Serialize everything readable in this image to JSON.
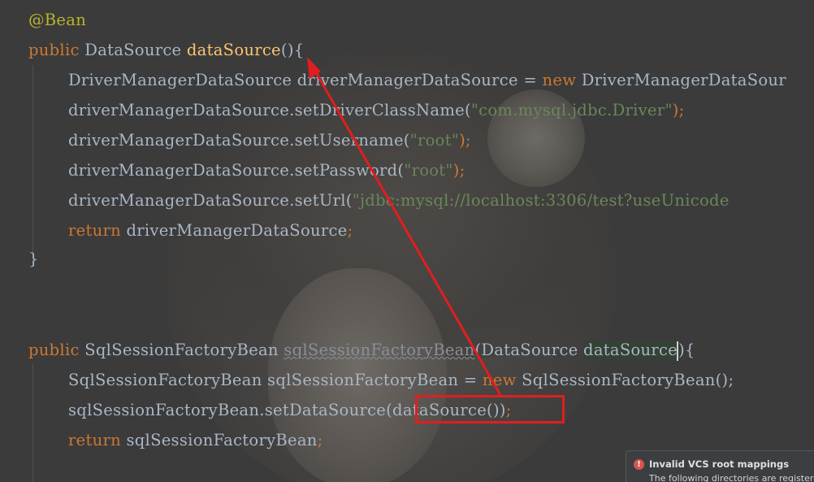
{
  "code_lines": {
    "l1": {
      "annotation": "@Bean"
    },
    "l2": {
      "kw": "public ",
      "type": "DataSource ",
      "method": "dataSource",
      "rest": "(){"
    },
    "l3": {
      "a": "DriverManagerDataSource driverManagerDataSource = ",
      "kw": "new",
      "b": " DriverManagerDataSour"
    },
    "l4": {
      "a": "driverManagerDataSource.setDriverClassName(",
      "str": "\"com.mysql.jdbc.Driver\"",
      "b": ");"
    },
    "l5": {
      "a": "driverManagerDataSource.setUsername(",
      "str": "\"root\"",
      "b": ");"
    },
    "l6": {
      "a": "driverManagerDataSource.setPassword(",
      "str": "\"root\"",
      "b": ");"
    },
    "l7": {
      "a": "driverManagerDataSource.setUrl(",
      "str": "\"jdbc:mysql://localhost:3306/test?useUnicode"
    },
    "l8": {
      "kw": "return ",
      "a": "driverManagerDataSource",
      "b": ";"
    },
    "l9": {
      "a": "}"
    },
    "l10": {
      "kw": "public ",
      "type": "SqlSessionFactoryBean ",
      "method": "sqlSessionFactoryBean",
      "open": "(DataSource ",
      "param": "dataSource",
      "close": "){"
    },
    "l11": {
      "a": "SqlSessionFactoryBean sqlSessionFactoryBean = ",
      "kw": "new",
      "b": " SqlSessionFactoryBean();"
    },
    "l12": {
      "a": "sqlSessionFactoryBean.setDataSource",
      "boxed": "(dataSource())",
      "b": ";"
    },
    "l13": {
      "kw": "return ",
      "a": "sqlSessionFactoryBean",
      "b": ";"
    }
  },
  "notification": {
    "icon": "error-icon",
    "title": "Invalid VCS root mappings",
    "body": "The following directories are registered"
  },
  "colors": {
    "keyword": "#cc7832",
    "annotation": "#bbb529",
    "method": "#ffc66d",
    "string": "#6a8759",
    "default": "#a9b7c6",
    "highlight": "#e11e1e"
  }
}
